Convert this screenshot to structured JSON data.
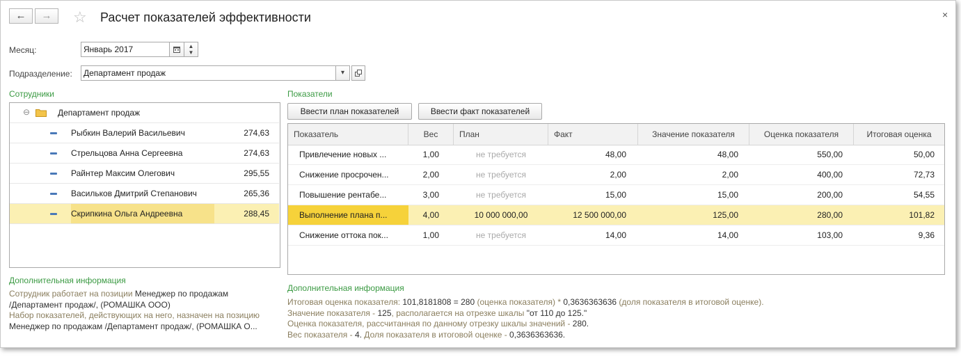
{
  "window": {
    "title": "Расчет показателей эффективности",
    "back_icon": "←",
    "forward_icon": "→",
    "star_icon": "☆",
    "close_icon": "×"
  },
  "form": {
    "month_label": "Месяц:",
    "month_value": "Январь 2017",
    "department_label": "Подразделение:",
    "department_value": "Департамент продаж"
  },
  "employees": {
    "section_title": "Сотрудники",
    "group": "Департамент продаж",
    "rows": [
      {
        "name": "Рыбкин Валерий Васильевич",
        "value": "274,63"
      },
      {
        "name": "Стрельцова Анна Сергеевна",
        "value": "274,63"
      },
      {
        "name": "Райнтер Максим Олегович",
        "value": "295,55"
      },
      {
        "name": "Васильков Дмитрий Степанович",
        "value": "265,36"
      },
      {
        "name": "Скрипкина Ольга Андреевна",
        "value": "288,45"
      }
    ],
    "selected_index": 4
  },
  "left_info": {
    "title": "Дополнительная информация",
    "line1_a": "Сотрудник работает на позиции ",
    "line1_b": "Менеджер по продажам",
    "line2": "/Департамент продаж/, (РОМАШКА ООО)",
    "line3": "Набор показателей, действующих на него, назначен на позицию",
    "line4": "Менеджер по продажам /Департамент продаж/, (РОМАШКА О..."
  },
  "indicators": {
    "section_title": "Показатели",
    "btn_plan": "Ввести план показателей",
    "btn_fact": "Ввести факт показателей",
    "columns": [
      "Показатель",
      "Вес",
      "План",
      "Факт",
      "Значение показателя",
      "Оценка показателя",
      "Итоговая оценка"
    ],
    "rows": [
      {
        "name": "Привлечение новых ...",
        "weight": "1,00",
        "plan": "не требуется",
        "fact": "48,00",
        "value": "48,00",
        "score": "550,00",
        "total": "50,00"
      },
      {
        "name": "Снижение просрочен...",
        "weight": "2,00",
        "plan": "не требуется",
        "fact": "2,00",
        "value": "2,00",
        "score": "400,00",
        "total": "72,73"
      },
      {
        "name": "Повышение рентабе...",
        "weight": "3,00",
        "plan": "не требуется",
        "fact": "15,00",
        "value": "15,00",
        "score": "200,00",
        "total": "54,55"
      },
      {
        "name": "Выполнение плана п...",
        "weight": "4,00",
        "plan": "10 000 000,00",
        "fact": "12 500 000,00",
        "value": "125,00",
        "score": "280,00",
        "total": "101,82"
      },
      {
        "name": "Снижение оттока пок...",
        "weight": "1,00",
        "plan": "не требуется",
        "fact": "14,00",
        "value": "14,00",
        "score": "103,00",
        "total": "9,36"
      }
    ],
    "selected_index": 3
  },
  "right_info": {
    "title": "Дополнительная информация",
    "l1_a": "Итоговая оценка показателя: ",
    "l1_b": "101,8181808 = 280",
    "l1_c": " (оценка показателя) * ",
    "l1_d": "0,3636363636",
    "l1_e": " (доля показателя в итоговой оценке).",
    "l2_a": "Значение показателя - ",
    "l2_b": "125",
    "l2_c": ", располагается на отрезке шкалы ",
    "l2_d": "\"от 110 до 125.\"",
    "l3_a": "Оценка показателя, рассчитанная по данному отрезку шкалы значений - ",
    "l3_b": "280.",
    "l4_a": "Вес показателя - ",
    "l4_b": "4.",
    "l4_c": " Доля показателя в итоговой оценке - ",
    "l4_d": "0,3636363636."
  },
  "colors": {
    "section_green": "#3b9a43",
    "selected_row": "#fbf0b3",
    "current_cell": "#f6d23a"
  }
}
